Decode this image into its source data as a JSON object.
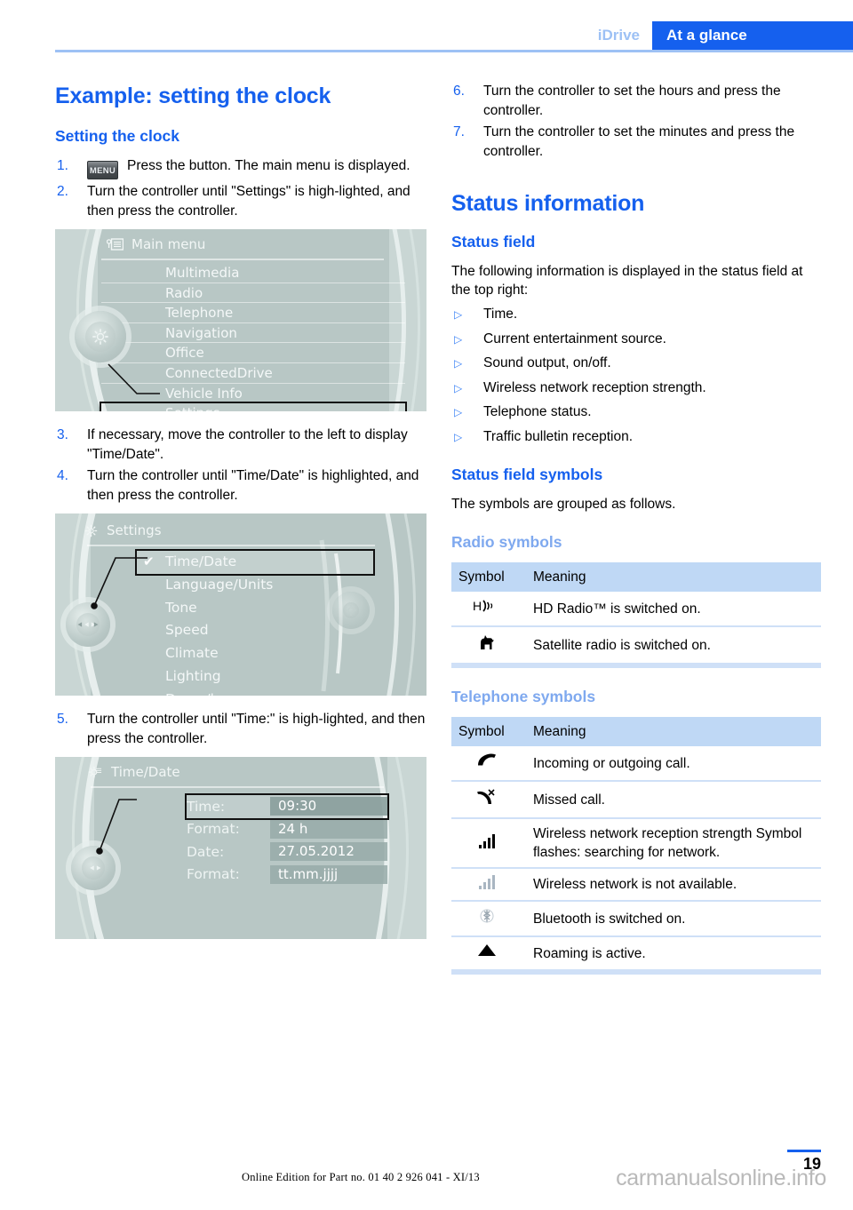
{
  "header": {
    "tab_inactive": "iDrive",
    "tab_active": "At a glance"
  },
  "left": {
    "heading": "Example: setting the clock",
    "subheading": "Setting the clock",
    "steps": [
      {
        "num": "1.",
        "icon": "MENU",
        "text": "Press the button. The main menu is displayed."
      },
      {
        "num": "2.",
        "text": "Turn the controller until \"Settings\" is high-lighted, and then press the controller."
      },
      {
        "num": "3.",
        "text": "If necessary, move the controller to the left to display \"Time/Date\"."
      },
      {
        "num": "4.",
        "text": "Turn the controller until \"Time/Date\" is highlighted, and then press the controller."
      },
      {
        "num": "5.",
        "text": "Turn the controller until \"Time:\" is high-lighted, and then press the controller."
      }
    ],
    "screen_main_menu": {
      "title": "Main menu",
      "title_icon": "list-menu-icon",
      "knob_icon": "gear-icon",
      "items": [
        {
          "label": "Multimedia",
          "selected": false
        },
        {
          "label": "Radio",
          "selected": false
        },
        {
          "label": "Telephone",
          "selected": false
        },
        {
          "label": "Navigation",
          "selected": false
        },
        {
          "label": "Office",
          "selected": false
        },
        {
          "label": "ConnectedDrive",
          "selected": false
        },
        {
          "label": "Vehicle Info",
          "selected": false
        },
        {
          "label": "Settings",
          "selected": true
        }
      ]
    },
    "screen_settings": {
      "title": "Settings",
      "title_icon": "gear-icon",
      "knob_icon": "left-right-arrows-icon",
      "items": [
        {
          "label": "Time/Date",
          "selected": true,
          "check": "✔"
        },
        {
          "label": "Language/Units",
          "selected": false
        },
        {
          "label": "Tone",
          "selected": false
        },
        {
          "label": "Speed",
          "selected": false
        },
        {
          "label": "Climate",
          "selected": false
        },
        {
          "label": "Lighting",
          "selected": false
        },
        {
          "label": "Doors/key",
          "selected": false
        }
      ]
    },
    "screen_time_date": {
      "title": "Time/Date",
      "title_icon": "gear-clock-icon",
      "knob_icon": "left-right-arrows-icon",
      "rows": [
        {
          "label": "Time:",
          "value": "09:30",
          "selected": true
        },
        {
          "label": "Format:",
          "value": "24 h",
          "selected": false
        },
        {
          "label": "Date:",
          "value": "27.05.2012",
          "selected": false
        },
        {
          "label": "Format:",
          "value": "tt.mm.jjjj",
          "selected": false
        }
      ]
    }
  },
  "right": {
    "steps": [
      {
        "num": "6.",
        "text": "Turn the controller to set the hours and press the controller."
      },
      {
        "num": "7.",
        "text": "Turn the controller to set the minutes and press the controller."
      }
    ],
    "heading": "Status information",
    "status_field_heading": "Status field",
    "status_field_intro": "The following information is displayed in the status field at the top right:",
    "status_field_items": [
      "Time.",
      "Current entertainment source.",
      "Sound output, on/off.",
      "Wireless network reception strength.",
      "Telephone status.",
      "Traffic bulletin reception."
    ],
    "symbols_heading": "Status field symbols",
    "symbols_intro": "The symbols are grouped as follows.",
    "radio": {
      "group_heading": "Radio symbols",
      "columns": [
        "Symbol",
        "Meaning"
      ],
      "rows": [
        {
          "icon": "hd-radio-icon",
          "glyph": "H)",
          "meaning": "HD Radio™ is switched on."
        },
        {
          "icon": "satellite-radio-dog-icon",
          "glyph": "",
          "meaning": "Satellite radio is switched on."
        }
      ]
    },
    "telephone": {
      "group_heading": "Telephone symbols",
      "columns": [
        "Symbol",
        "Meaning"
      ],
      "rows": [
        {
          "icon": "handset-icon",
          "meaning": "Incoming or outgoing call."
        },
        {
          "icon": "missed-call-icon",
          "meaning": "Missed call."
        },
        {
          "icon": "signal-bars-icon",
          "meaning": "Wireless network reception strength Symbol flashes: searching for network."
        },
        {
          "icon": "signal-bars-gray-icon",
          "meaning": "Wireless network is not available."
        },
        {
          "icon": "bluetooth-icon",
          "meaning": "Bluetooth is switched on."
        },
        {
          "icon": "roaming-triangle-icon",
          "meaning": "Roaming is active."
        }
      ]
    }
  },
  "footer": {
    "online_edition": "Online Edition for Part no. 01 40 2 926 041 - XI/13",
    "page_number": "19",
    "watermark": "carmanualsonline.info"
  },
  "colors": {
    "accent_blue": "#1560ee",
    "light_blue": "#7fa9ef",
    "table_header": "#bfd8f5",
    "table_border": "#cfe0f7",
    "idrive_bg": "#c9d6d4"
  }
}
